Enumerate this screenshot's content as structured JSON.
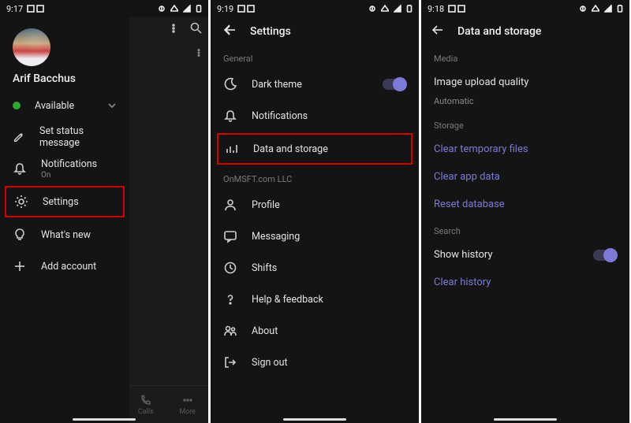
{
  "screens": {
    "hamburger": {
      "time": "9:17",
      "username": "Arif Bacchus",
      "presence": "Available",
      "items": {
        "set_status": "Set status message",
        "notifications": "Notifications",
        "notifications_sub": "On",
        "settings": "Settings",
        "whats_new": "What's new",
        "add_account": "Add account"
      },
      "bottom_tabs": {
        "calls": "Calls",
        "more": "More"
      }
    },
    "settings": {
      "time": "9:19",
      "title": "Settings",
      "sections": {
        "general": "General",
        "org": "OnMSFT.com LLC"
      },
      "items": {
        "dark_theme": "Dark theme",
        "notifications": "Notifications",
        "data_storage": "Data and storage",
        "profile": "Profile",
        "messaging": "Messaging",
        "shifts": "Shifts",
        "help_feedback": "Help & feedback",
        "about": "About",
        "sign_out": "Sign out"
      }
    },
    "data_storage": {
      "time": "9:18",
      "title": "Data and storage",
      "sections": {
        "media": "Media",
        "storage": "Storage",
        "search": "Search"
      },
      "items": {
        "image_upload_quality": "Image upload quality",
        "image_upload_quality_value": "Automatic",
        "clear_temp": "Clear temporary files",
        "clear_app": "Clear app data",
        "reset_db": "Reset database",
        "show_history": "Show history",
        "clear_history": "Clear history"
      }
    }
  }
}
